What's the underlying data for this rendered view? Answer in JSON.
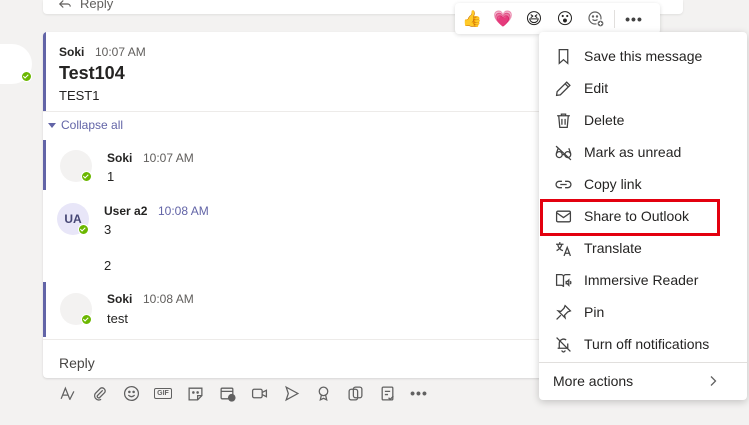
{
  "previous": {
    "reply_label": "Reply"
  },
  "root_message": {
    "author": "Soki",
    "time": "10:07 AM",
    "subject": "Test104",
    "body": "TEST1"
  },
  "thread": {
    "collapse_label": "Collapse all",
    "replies": [
      {
        "author": "Soki",
        "time": "10:07 AM",
        "body": "1"
      },
      {
        "author": "User a2",
        "initials": "UA",
        "time": "10:08 AM",
        "body": "3",
        "body2": "2"
      },
      {
        "author": "Soki",
        "time": "10:08 AM",
        "body": "test"
      }
    ],
    "reply_placeholder": "Reply"
  },
  "reactions": {
    "items": [
      "👍",
      "💗",
      "😆",
      "😮",
      "emoji-add-icon"
    ],
    "more_icon": "more-icon"
  },
  "context_menu": {
    "items": [
      {
        "label": "Save this message",
        "icon": "bookmark-icon"
      },
      {
        "label": "Edit",
        "icon": "pencil-icon"
      },
      {
        "label": "Delete",
        "icon": "trash-icon"
      },
      {
        "label": "Mark as unread",
        "icon": "glasses-icon"
      },
      {
        "label": "Copy link",
        "icon": "link-icon"
      },
      {
        "label": "Share to Outlook",
        "icon": "mail-icon"
      },
      {
        "label": "Translate",
        "icon": "translate-icon"
      },
      {
        "label": "Immersive Reader",
        "icon": "immersive-reader-icon"
      },
      {
        "label": "Pin",
        "icon": "pin-icon"
      },
      {
        "label": "Turn off notifications",
        "icon": "bell-off-icon"
      }
    ],
    "more_actions": "More actions",
    "highlighted_item": "Share to Outlook",
    "highlight_color": "#e3000f"
  },
  "composer_icons": [
    "format-icon",
    "attach-icon",
    "emoji-icon",
    "gif-icon",
    "sticker-icon",
    "meet-now-icon",
    "video-icon",
    "stream-icon",
    "praise-icon",
    "loop-icon",
    "approvals-icon",
    "more-icon"
  ],
  "colors": {
    "accent": "#6264a7",
    "presence": "#6bb700",
    "background": "#f3f2f1"
  }
}
